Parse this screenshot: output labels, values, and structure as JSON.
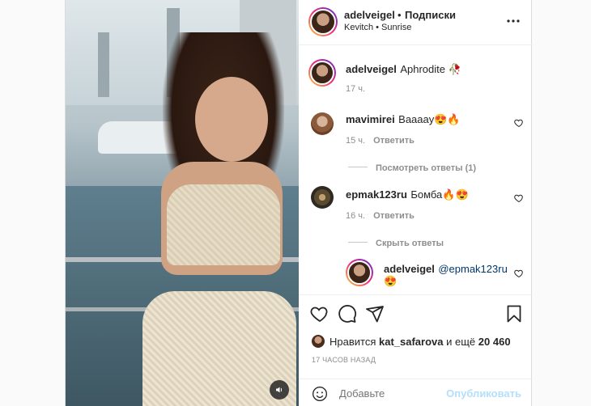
{
  "post": {
    "author": "adelveigel",
    "separator": "•",
    "follow_label": "Подписки",
    "audio": "Kevitch • Sunrise"
  },
  "caption": {
    "username": "adelveigel",
    "text": "Aphrodite 🥀",
    "time": "17 ч."
  },
  "comments": [
    {
      "username": "mavimirei",
      "text": "Вааааy😍🔥",
      "time": "15 ч.",
      "reply_label": "Ответить",
      "thread_label": "Посмотреть ответы (1)"
    },
    {
      "username": "epmak123ru",
      "text": "Бомба🔥😍",
      "time": "16 ч.",
      "reply_label": "Ответить",
      "thread_label": "Скрыть ответы"
    }
  ],
  "reply": {
    "username": "adelveigel",
    "mention": "@epmak123ru",
    "emoji": "😍"
  },
  "likes": {
    "prefix": "Нравится",
    "user": "kat_safarova",
    "middle": "и ещё",
    "count": "20 460"
  },
  "time_ago": "17 ЧАСОВ НАЗАД",
  "add_comment": {
    "placeholder": "Добавьте",
    "post_label": "Опубликовать"
  },
  "icons": [
    "more-icon",
    "heart-icon",
    "comment-icon",
    "share-icon",
    "bookmark-icon",
    "emoji-icon",
    "sound-icon"
  ],
  "colors": {
    "accent": "#0095f6",
    "post_disabled": "#b2dffc",
    "mention": "#00376b",
    "muted": "#8e8e8e"
  }
}
